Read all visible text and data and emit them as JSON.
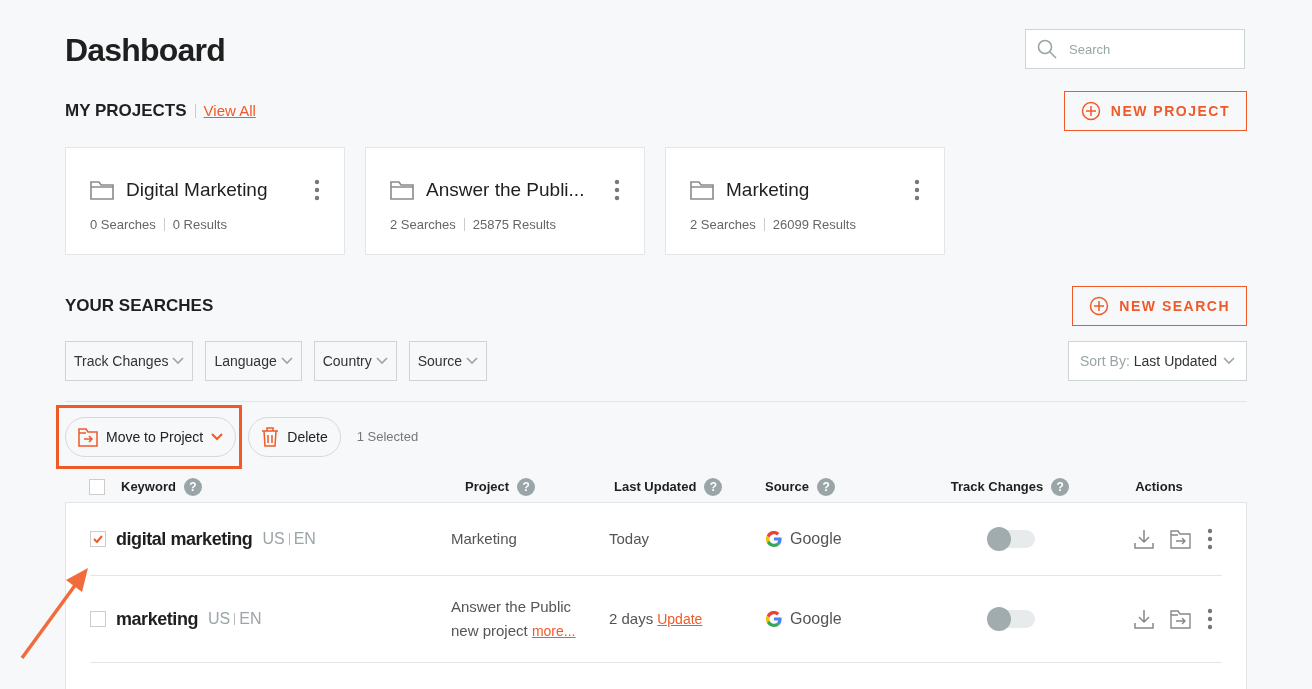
{
  "title": "Dashboard",
  "search": {
    "placeholder": "Search"
  },
  "projects_section": {
    "heading": "MY PROJECTS",
    "view_all": "View All",
    "new_button": "NEW PROJECT"
  },
  "projects": [
    {
      "name": "Digital Marketing",
      "searches": "0 Searches",
      "results": "0 Results"
    },
    {
      "name": "Answer the Publi...",
      "searches": "2 Searches",
      "results": "25875 Results"
    },
    {
      "name": "Marketing",
      "searches": "2 Searches",
      "results": "26099 Results"
    }
  ],
  "searches_section": {
    "heading": "YOUR SEARCHES",
    "new_button": "NEW SEARCH"
  },
  "filters": [
    "Track Changes",
    "Language",
    "Country",
    "Source"
  ],
  "sort": {
    "label": "Sort By:",
    "value": "Last Updated"
  },
  "bulk_actions": {
    "move": "Move to Project",
    "delete": "Delete",
    "selected_count": "1 Selected",
    "highlighted": true
  },
  "table": {
    "select_all": {
      "checked": false
    },
    "columns": [
      {
        "label": "Keyword",
        "help": "?"
      },
      {
        "label": "Project",
        "help": "?"
      },
      {
        "label": "Last Updated",
        "help": "?"
      },
      {
        "label": "Source",
        "help": "?"
      },
      {
        "label": "Track Changes",
        "help": "?"
      },
      {
        "label": "Actions"
      }
    ],
    "rows": [
      {
        "checked": true,
        "keyword": "digital marketing",
        "country": "US",
        "language": "EN",
        "project": "Marketing",
        "more": null,
        "updated": "Today",
        "update_link": null,
        "source": "Google",
        "track_changes": false
      },
      {
        "checked": false,
        "keyword": "marketing",
        "country": "US",
        "language": "EN",
        "project": "Answer the Public new project",
        "more": "more...",
        "updated": "2 days",
        "update_link": "Update",
        "source": "Google",
        "track_changes": false
      }
    ]
  }
}
